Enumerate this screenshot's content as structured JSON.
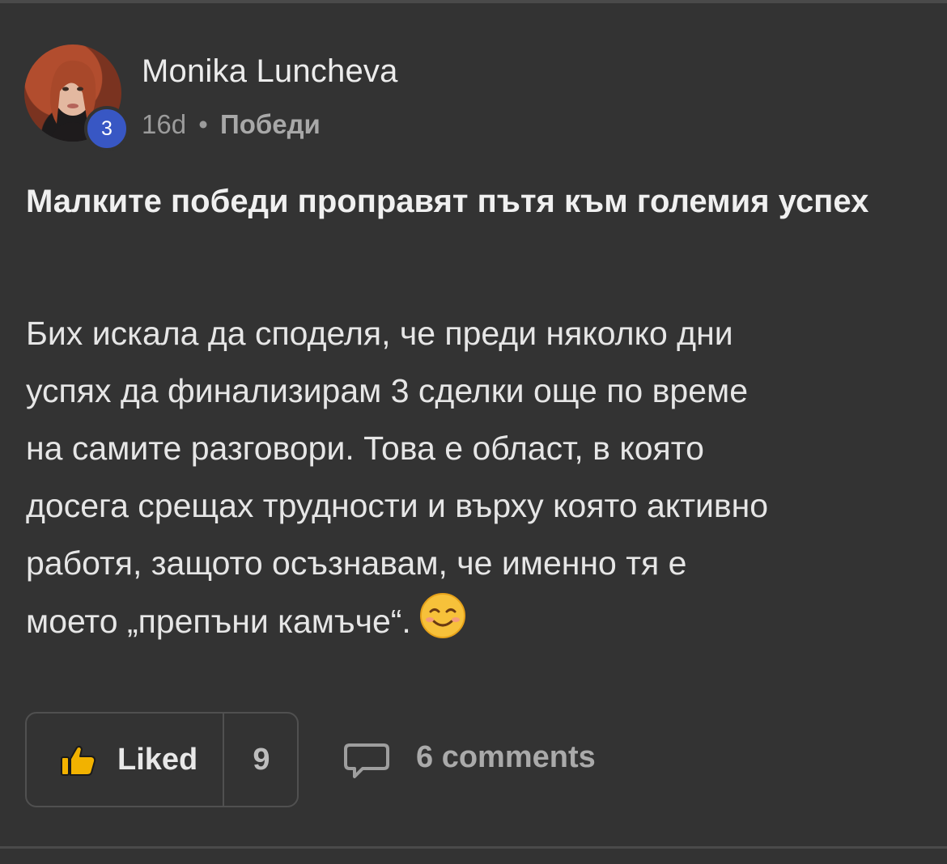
{
  "author": {
    "name": "Monika Luncheva",
    "level": "3",
    "avatar_icon": "user-photo"
  },
  "meta": {
    "time_ago": "16d",
    "separator": "•",
    "category": "Победи"
  },
  "post": {
    "title": "Малките победи проправят пътя към големия успех",
    "body_lines": [
      "Бих искала да споделя, че преди няколко дни",
      "успях да финализирам 3 сделки още по време",
      "на самите разговори. Това е област, в която",
      "досега срещах трудности и върху която активно",
      "работя, защото осъзнавам, че именно тя е",
      "моето „препъни камъче“."
    ],
    "emoji_icon": "smiling-face-emoji"
  },
  "actions": {
    "like_label": "Liked",
    "like_count": "9",
    "like_icon": "thumbs-up-icon",
    "comments_label": "6 comments",
    "comment_icon": "speech-bubble-icon"
  },
  "colors": {
    "background": "#333333",
    "badge": "#3857c4",
    "thumb": "#f2b200"
  }
}
